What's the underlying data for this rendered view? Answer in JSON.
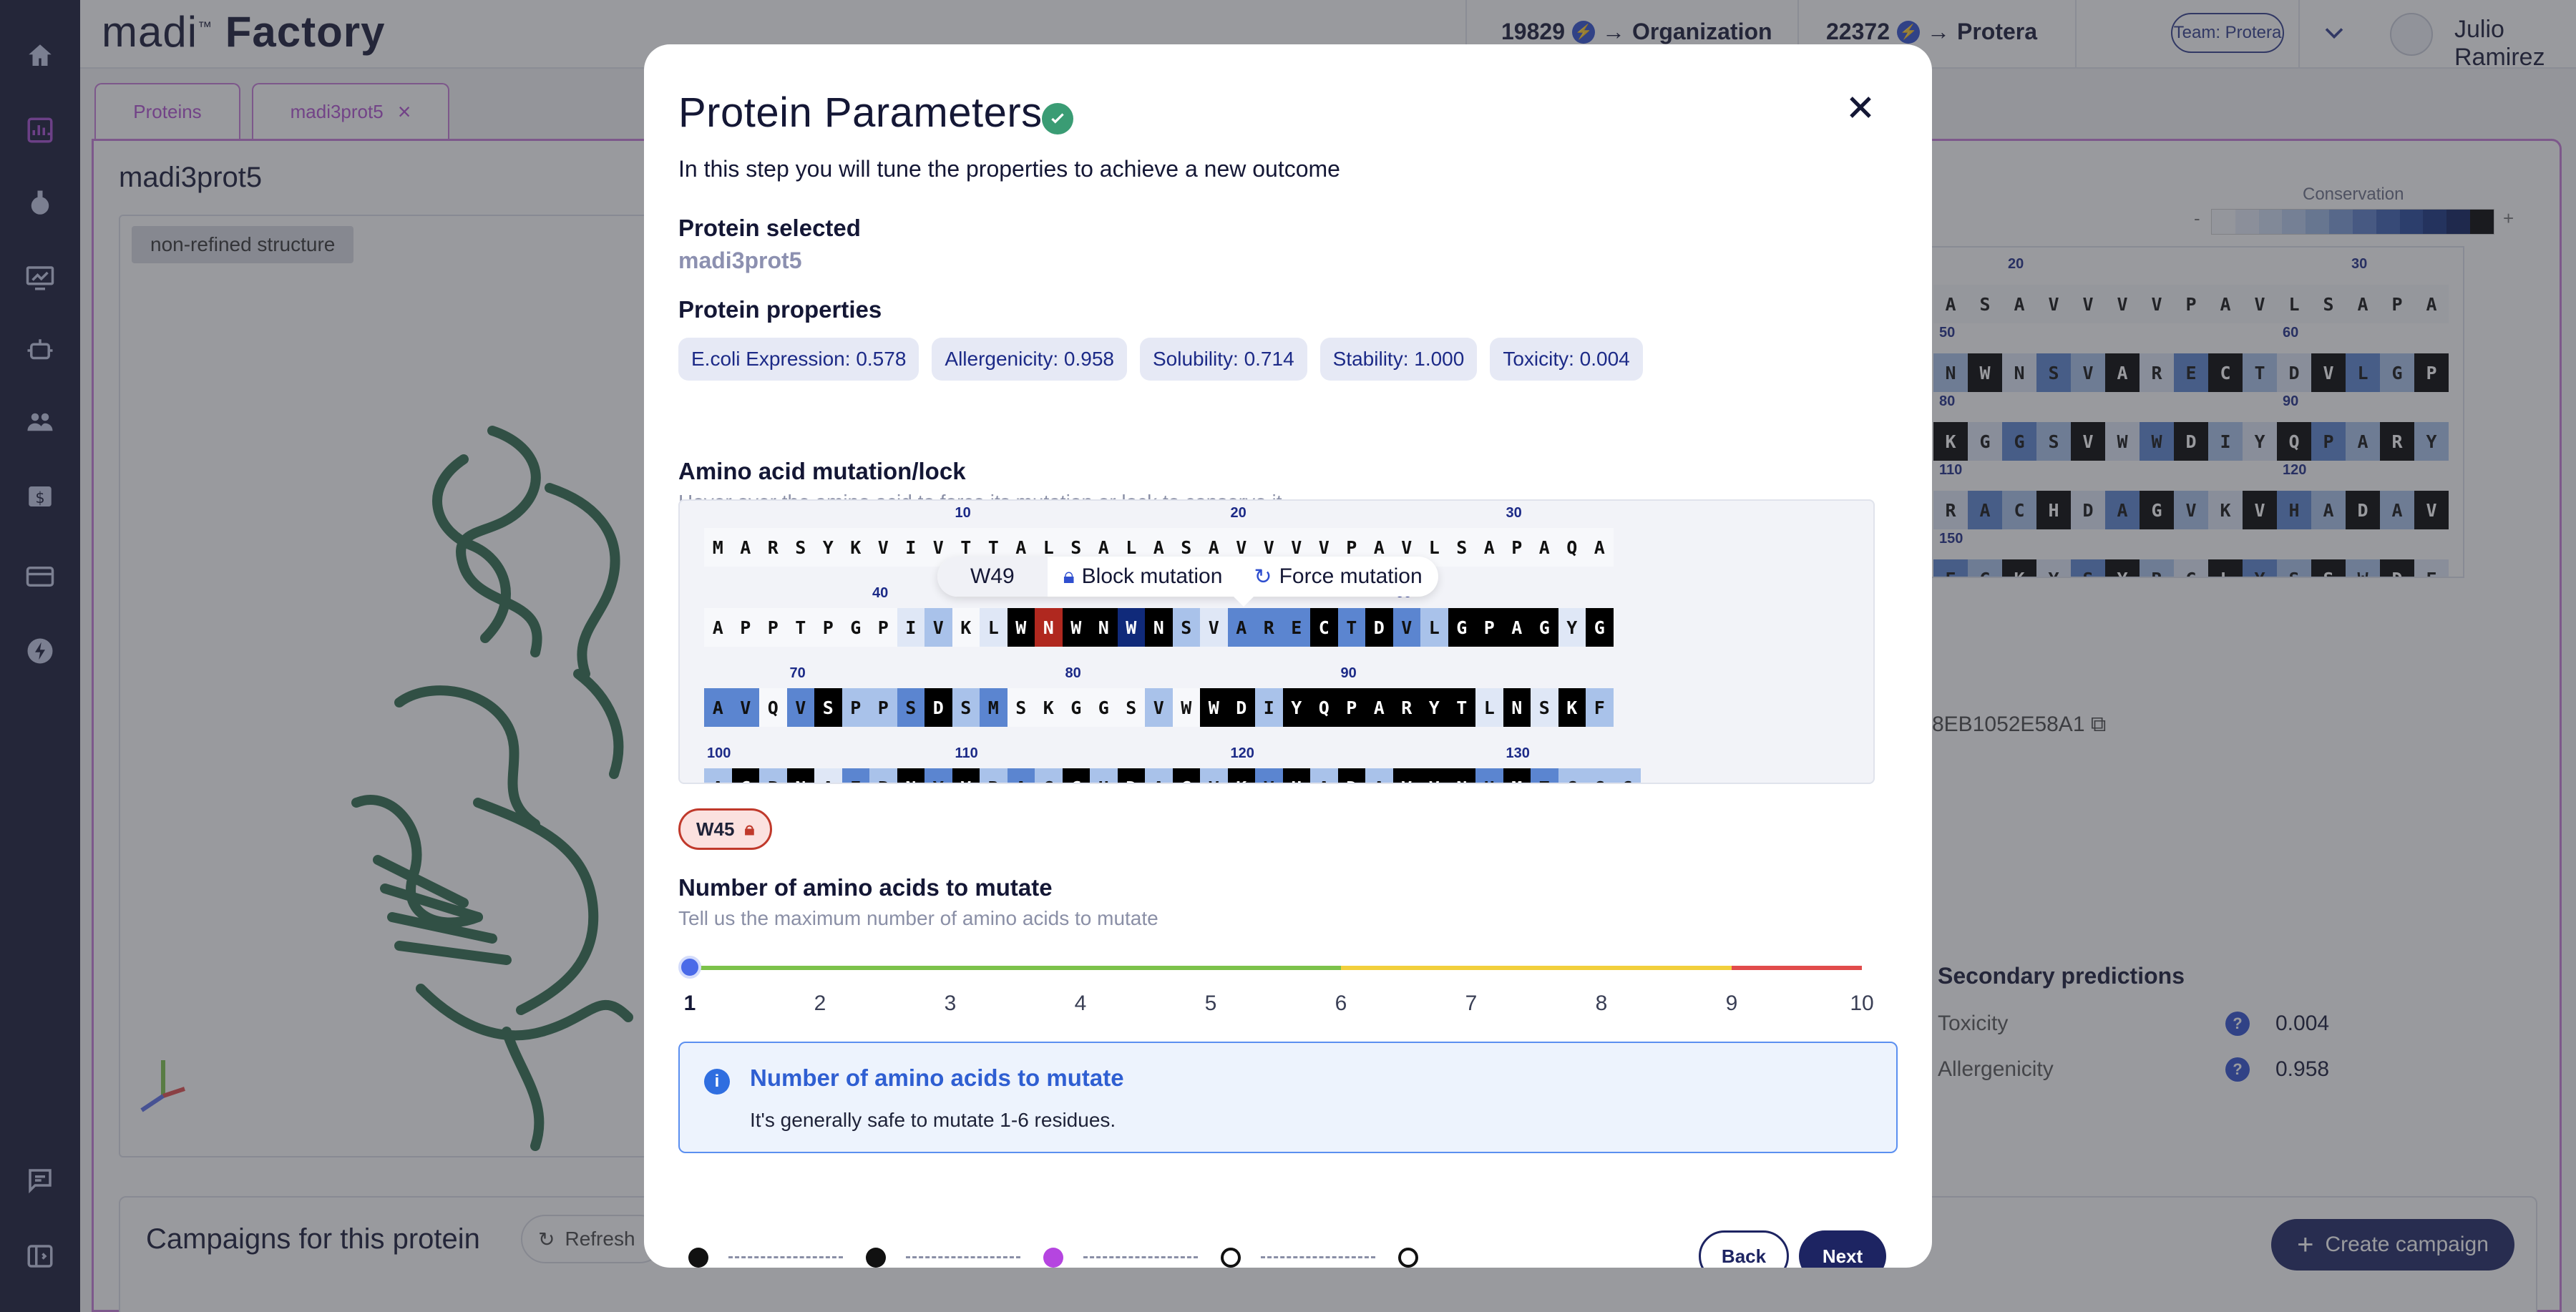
{
  "app": {
    "logo_text": "madi",
    "logo_suffix": "Factory",
    "credits": [
      {
        "amount": "19829",
        "target": "Organization"
      },
      {
        "amount": "22372",
        "target": "Protera"
      }
    ],
    "team_label": "Team: Protera",
    "user_name": "Julio Ramirez"
  },
  "sidebar_icons": [
    "home-icon",
    "dashboard-chart-icon",
    "flask-icon",
    "monitor-chart-icon",
    "robot-icon",
    "users-icon",
    "billing-icon",
    "card-icon",
    "bolt-icon",
    "feedback-icon",
    "collapse-panel-icon"
  ],
  "tabs": [
    {
      "label": "Proteins"
    },
    {
      "label": "madi3prot5"
    }
  ],
  "background_page": {
    "protein_title": "madi3prot5",
    "structure_badge": "non-refined structure",
    "conservation_label": "Conservation",
    "cons_minus": "-",
    "cons_plus": "+",
    "uuid_fragment": "-8EB1052E58A1",
    "secondary_predictions_title": "Secondary predictions",
    "predictions": [
      {
        "label": "Toxicity",
        "value": "0.004"
      },
      {
        "label": "Allergenicity",
        "value": "0.958"
      }
    ],
    "campaigns_title": "Campaigns for this protein",
    "refresh_label": "Refresh",
    "create_campaign_label": "Create campaign",
    "right_seq": {
      "numbers": [
        {
          "n": "20",
          "col": 2
        },
        {
          "n": "30",
          "col": 12
        },
        {
          "n": "50",
          "col": 0
        },
        {
          "n": "60",
          "col": 10
        },
        {
          "n": "80",
          "col": 0
        },
        {
          "n": "90",
          "col": 10
        },
        {
          "n": "110",
          "col": 0
        },
        {
          "n": "120",
          "col": 10
        },
        {
          "n": "150",
          "col": 0
        }
      ],
      "rows": [
        "ASAVVVVPAVLSAPA",
        "NWNSVARECTDVLGP",
        "KGGSVWWDIYQPARY",
        "RACHDAGVKVHADAV",
        "EGKYSYRGLYSSWDE"
      ]
    }
  },
  "modal": {
    "title": "Protein Parameters",
    "subtitle": "In this step you will tune the properties to achieve a new outcome",
    "protein_selected_label": "Protein selected",
    "protein_selected_value": "madi3prot5",
    "protein_properties_label": "Protein properties",
    "properties": [
      {
        "label": "E.coli Expression: 0.578"
      },
      {
        "label": "Allergenicity: 0.958"
      },
      {
        "label": "Solubility: 0.714"
      },
      {
        "label": "Stability: 1.000"
      },
      {
        "label": "Toxicity: 0.004"
      }
    ],
    "mutation_label": "Amino acid mutation/lock",
    "mutation_hint": "Hover over the amino acid to force its mutation or lock to conserve it.",
    "sequence": {
      "number_markers": [
        {
          "row": 0,
          "n": "10",
          "col": 9
        },
        {
          "row": 0,
          "n": "20",
          "col": 19
        },
        {
          "row": 0,
          "n": "30",
          "col": 29
        },
        {
          "row": 1,
          "n": "40",
          "col": 6
        },
        {
          "row": 1,
          "n": "60",
          "col": 25
        },
        {
          "row": 2,
          "n": "70",
          "col": 3
        },
        {
          "row": 2,
          "n": "80",
          "col": 13
        },
        {
          "row": 2,
          "n": "90",
          "col": 23
        },
        {
          "row": 3,
          "n": "100",
          "col": 0
        },
        {
          "row": 3,
          "n": "110",
          "col": 9
        },
        {
          "row": 3,
          "n": "120",
          "col": 19
        },
        {
          "row": 3,
          "n": "130",
          "col": 29
        }
      ],
      "rows": [
        {
          "residues": "MARSYKVIVTTALSALASAVVVVPAVLSAPAQA",
          "shades": "000000000000000000000000000000000"
        },
        {
          "residues": "APPTPGPIVKLWNWNWNSVARECTDVLGPAGYG",
          "shades": "000000012014r4454213334343244441423"
        },
        {
          "residues": "AVQVSPPSDSMSKGGSVWWDIYQPARYTLNSKF",
          "shades": "330342234230000020442444444414142140"
        },
        {
          "residues": "ACPNAEPNYVRAGCHDAGVKVHADAVVNHMTGGC",
          "shades": "2424132434232424242434242444343222"
        }
      ]
    },
    "tooltip": {
      "residue": "W49",
      "block_label": "Block mutation",
      "force_label": "Force mutation"
    },
    "locked_chip": "W45",
    "num_mutate_label": "Number of amino acids to mutate",
    "num_mutate_hint": "Tell us the maximum number of amino acids to mutate",
    "slider": {
      "min": 1,
      "max": 10,
      "value": 1,
      "ticks": [
        "1",
        "2",
        "3",
        "4",
        "5",
        "6",
        "7",
        "8",
        "9",
        "10"
      ],
      "zone_colors": [
        "#7cc24a",
        "#f2cf3c",
        "#e14b4b"
      ]
    },
    "info": {
      "title": "Number of amino acids to mutate",
      "text": "It's generally safe to mutate 1-6 residues."
    },
    "steps": [
      "done",
      "done",
      "current",
      "todo",
      "todo"
    ],
    "back_label": "Back",
    "next_label": "Next"
  }
}
